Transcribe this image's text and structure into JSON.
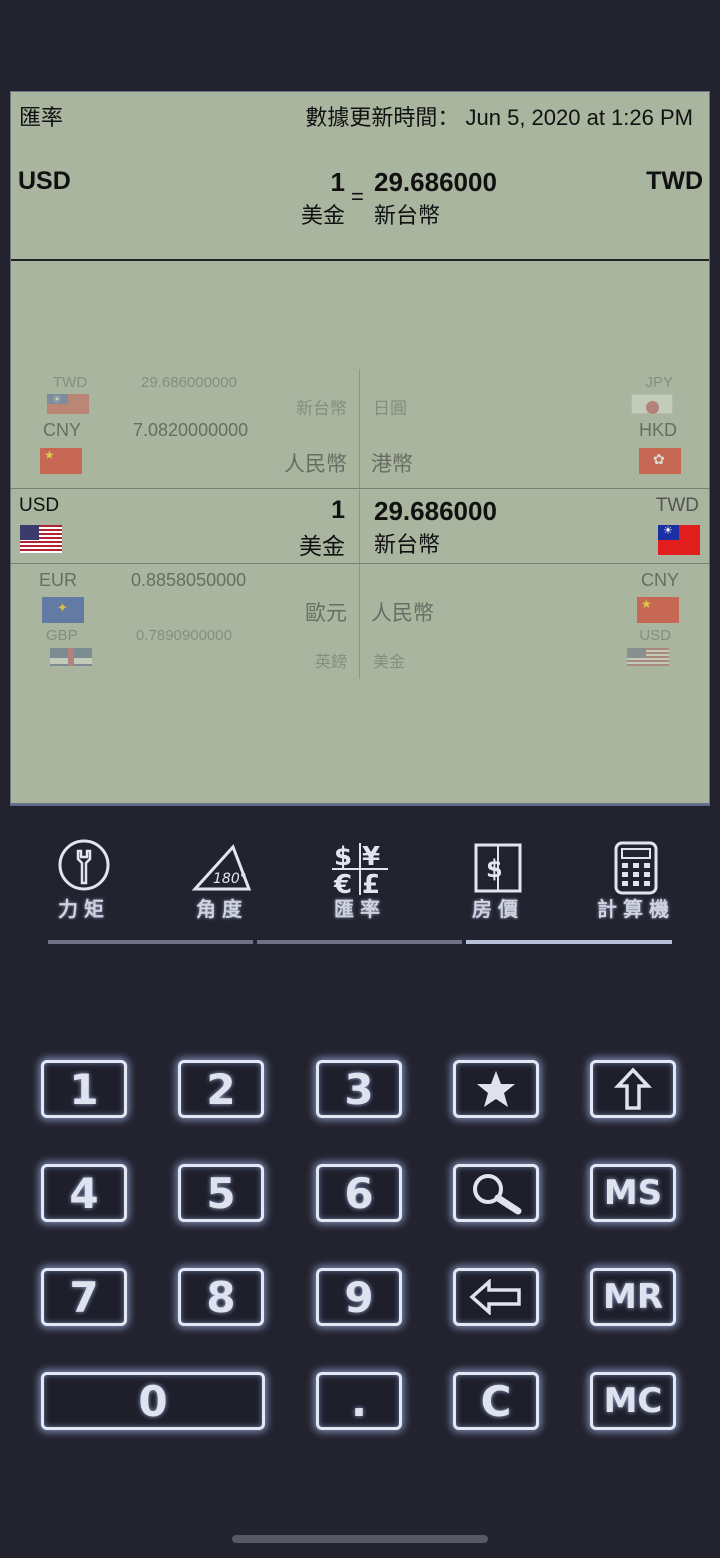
{
  "header": {
    "title": "匯率",
    "update_label": "數據更新時間：",
    "update_time": "Jun 5, 2020 at 1:26 PM"
  },
  "conversion": {
    "from_code": "USD",
    "from_amount": "1",
    "from_name": "美金",
    "equals": "=",
    "result": "29.686000",
    "to_name": "新台幣",
    "to_code": "TWD"
  },
  "picker": {
    "left_above": [
      {
        "code": "TWD",
        "rate": "29.686000000",
        "name": "新台幣",
        "flag": "tw"
      },
      {
        "code": "CNY",
        "rate": "7.0820000000",
        "name": "人民幣",
        "flag": "cn"
      }
    ],
    "left_selected": {
      "code": "USD",
      "amount": "1",
      "name": "美金",
      "flag": "us"
    },
    "left_below": [
      {
        "code": "EUR",
        "rate": "0.8858050000",
        "name": "歐元",
        "flag": "eu"
      },
      {
        "code": "GBP",
        "rate": "0.7890900000",
        "name": "英鎊",
        "flag": "gb"
      }
    ],
    "right_above": [
      {
        "code": "JPY",
        "name": "日圓",
        "flag": "jp"
      },
      {
        "code": "HKD",
        "name": "港幣",
        "flag": "hk"
      }
    ],
    "right_selected": {
      "code": "TWD",
      "value": "29.686000",
      "name": "新台幣",
      "flag": "tw"
    },
    "right_below": [
      {
        "code": "CNY",
        "name": "人民幣",
        "flag": "cn"
      },
      {
        "code": "USD",
        "name": "美金",
        "flag": "us"
      }
    ]
  },
  "tabs": [
    {
      "label": "力矩",
      "icon": "wrench-icon",
      "active": false
    },
    {
      "label": "角度",
      "icon": "angle-icon",
      "active": false
    },
    {
      "label": "匯率",
      "icon": "currency-icon",
      "active": true
    },
    {
      "label": "房價",
      "icon": "house-price-icon",
      "active": false
    },
    {
      "label": "計算機",
      "icon": "calculator-icon",
      "active": false
    }
  ],
  "keypad": {
    "k1": "1",
    "k2": "2",
    "k3": "3",
    "k4": "4",
    "k5": "5",
    "k6": "6",
    "k7": "7",
    "k8": "8",
    "k9": "9",
    "k0": "0",
    "dot": ".",
    "clear": "C",
    "ms": "MS",
    "mr": "MR",
    "mc": "MC"
  }
}
